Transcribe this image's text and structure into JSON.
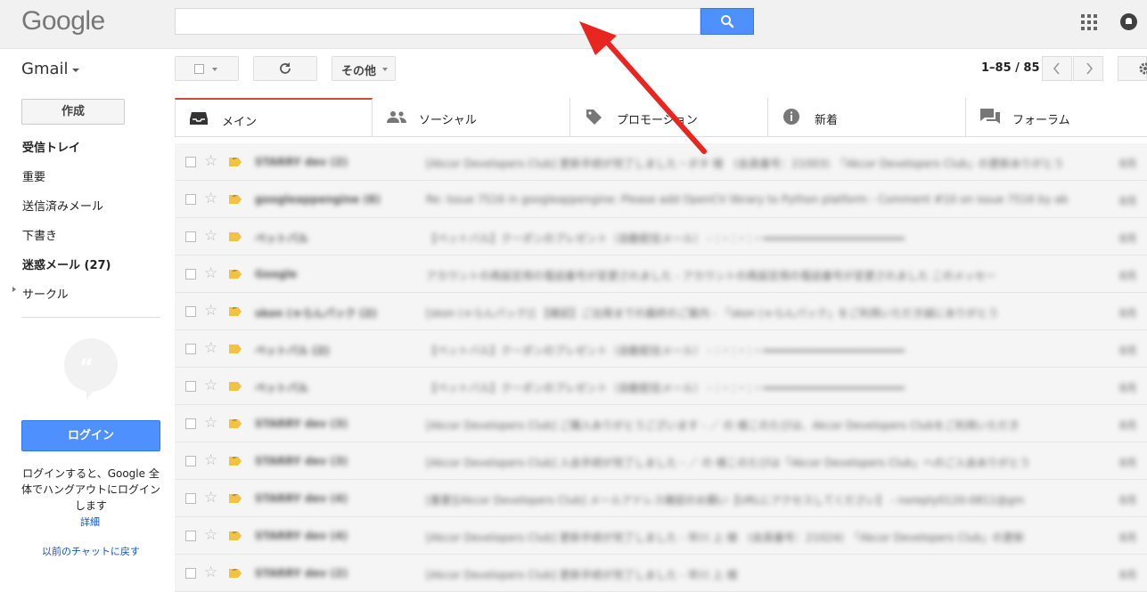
{
  "header": {
    "logo_text": "Google",
    "search_value": "",
    "search_placeholder": ""
  },
  "toolbar": {
    "app_label": "Gmail",
    "more_label": "その他",
    "page_range": "1–85 / 85"
  },
  "nav": {
    "compose_label": "作成",
    "items": [
      {
        "label": "受信トレイ",
        "bold": true
      },
      {
        "label": "重要",
        "bold": false
      },
      {
        "label": "送信済みメール",
        "bold": false
      },
      {
        "label": "下書き",
        "bold": false
      },
      {
        "label": "迷惑メール (27)",
        "bold": true
      },
      {
        "label": "サークル",
        "bold": false
      }
    ],
    "login_button_label": "ログイン",
    "login_text": "ログインすると、Google 全体でハングアウトにログインします",
    "details_link": "詳細",
    "back_to_chat_link": "以前のチャットに戻す"
  },
  "tabs": [
    {
      "label": "メイン",
      "icon": "inbox-icon",
      "active": true
    },
    {
      "label": "ソーシャル",
      "icon": "people-icon",
      "active": false
    },
    {
      "label": "プロモーション",
      "icon": "tag-icon",
      "active": false
    },
    {
      "label": "新着",
      "icon": "info-icon",
      "active": false
    },
    {
      "label": "フォーラム",
      "icon": "forum-icon",
      "active": false
    }
  ],
  "emails": [
    {
      "sender": "STARRY dev (2)",
      "subject": "[Akcor Developers Club] 更新手続が完了しました・ボタ 様　(会員番号：21003)　「Akcor Developers Club」の更新ありがとう",
      "date": "8月",
      "label": "important"
    },
    {
      "sender": "googleappengine (8)",
      "subject": "Re: Issue 7516 in googleappengine: Please add OpenCV library to Python platform - Comment #10 on issue 7516 by ab",
      "date": "8月",
      "label": "important"
    },
    {
      "sender": "ペットバル",
      "subject": "【ペットバル】クーポンのプレゼント（自動配信メール） - ：・：・：・━━━━━━━━━━━━━━━━━━━━━━",
      "date": "8月",
      "label": "normal"
    },
    {
      "sender": "Google",
      "subject": "アカウントの再設定用の電話番号が変更されました - アカウントの再設定用の電話番号が変更されました このメッセー",
      "date": "8月",
      "label": "important"
    },
    {
      "sender": "skon (ゃらんパック (2)",
      "subject": "[skon (ゃらんパック)] 【確認】ご出発までの最終のご案内 - 「skon (ゃらんパック」をご利用いただき誠にありがとう",
      "date": "8月",
      "label": "important"
    },
    {
      "sender": "ペットバル (2)",
      "subject": "【ペットバル】クーポンのプレゼント（自動配信メール） - ：・：・：・━━━━━━━━━━━━━━━━━━━━━━",
      "date": "8月",
      "label": "normal"
    },
    {
      "sender": "ペットバル",
      "subject": "【ペットバル】クーポンのプレゼント（自動配信メール） - ：・：・：・━━━━━━━━━━━━━━━━━━━━━━",
      "date": "8月",
      "label": "normal"
    },
    {
      "sender": "STARRY dev (3)",
      "subject": "[Akcor Developers Club] ご購入ありがとうございます - ／ の 様このたびは、Akcor Developers Clubをご利用いただき",
      "date": "8月",
      "label": "important"
    },
    {
      "sender": "STARRY dev (3)",
      "subject": "[Akcor Developers Club] 入会手続が完了しました - ／ の 様このたびは「Akcor Developers Club」へのご入会ありがとう",
      "date": "8月",
      "label": "important"
    },
    {
      "sender": "STARRY dev (4)",
      "subject": "[重要][Akcor Developers Club] メールアドレス確認のお願い【URLにアクセスしてください】 - noreply0120-0811@gm",
      "date": "8月",
      "label": "important"
    },
    {
      "sender": "STARRY dev (4)",
      "subject": "[Akcor Developers Club] 更新手続が完了しました - 早川 上 様　(会員番号：21024)　「Akcor Developers Club」の更新",
      "date": "8月",
      "label": "important"
    },
    {
      "sender": "STARRY dev (2)",
      "subject": "[Akcor Developers Club] 更新手続が完了しました - 早川 上 様",
      "date": "8月",
      "label": "important"
    }
  ]
}
